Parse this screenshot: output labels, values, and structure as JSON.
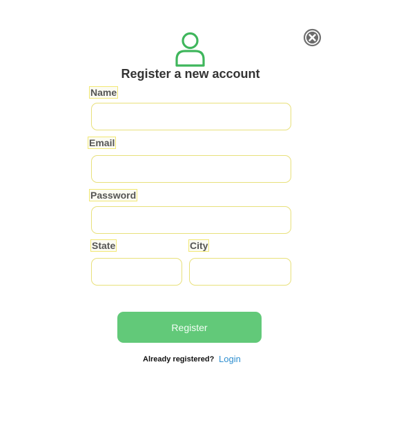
{
  "form": {
    "title": "Register a new account",
    "fields": {
      "name": {
        "label": "Name",
        "value": ""
      },
      "email": {
        "label": "Email",
        "value": ""
      },
      "password": {
        "label": "Password",
        "value": ""
      },
      "state": {
        "label": "State",
        "value": ""
      },
      "city": {
        "label": "City",
        "value": ""
      }
    },
    "submit_label": "Register",
    "footer": {
      "prompt": "Already registered?",
      "login_label": "Login"
    }
  },
  "icons": {
    "close": "close-circle-icon",
    "user": "user-outline-icon"
  },
  "colors": {
    "accent_green": "#62c979",
    "icon_green": "#3fb65c",
    "link_blue": "#2f8fd0",
    "field_border": "#e8e07a"
  }
}
